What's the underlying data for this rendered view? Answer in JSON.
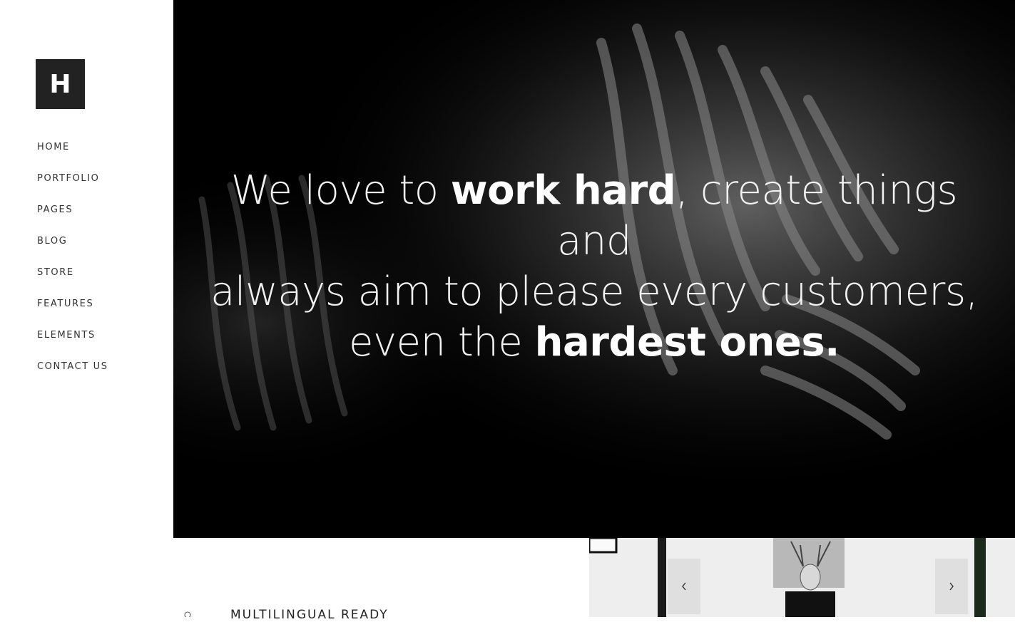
{
  "brand": {
    "logo_letter": "H"
  },
  "nav": {
    "items": [
      "HOME",
      "PORTFOLIO",
      "PAGES",
      "BLOG",
      "STORE",
      "FEATURES",
      "ELEMENTS",
      "CONTACT US"
    ]
  },
  "hero": {
    "line1_a": "We love to ",
    "line1_b": "work hard",
    "line1_c": ", create things and",
    "line2": "always aim to please every customers,",
    "line3_a": "even the ",
    "line3_b": "hardest ones."
  },
  "feature": {
    "title": "MULTILINGUAL READY"
  },
  "gallery": {
    "prev_icon": "chevron-left-icon",
    "next_icon": "chevron-right-icon"
  },
  "colors": {
    "logo_bg": "#222222",
    "hero_bg": "#000000",
    "text": "#333333"
  }
}
